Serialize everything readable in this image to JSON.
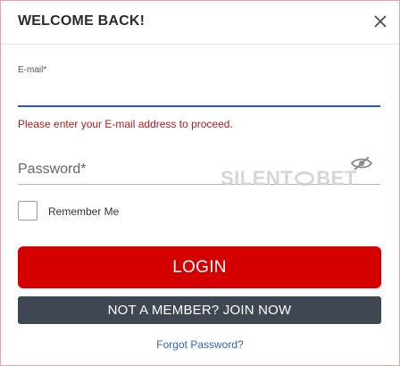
{
  "dialog": {
    "title": "WELCOME BACK!"
  },
  "form": {
    "email_label": "E-mail*",
    "email_value": "",
    "email_error": "Please enter your E-mail address to proceed.",
    "password_placeholder": "Password*",
    "password_value": "",
    "remember_label": "Remember Me",
    "remember_checked": false
  },
  "buttons": {
    "login_label": "LOGIN",
    "join_label": "NOT A MEMBER? JOIN NOW"
  },
  "links": {
    "forgot_password": "Forgot Password?"
  },
  "watermark": {
    "left": "SILENT",
    "right": "BET"
  },
  "icons": {
    "close": "close-icon",
    "password_toggle": "eye-slash-icon"
  },
  "colors": {
    "primary_red": "#d40000",
    "dark_button": "#3f4753",
    "error_text": "#b51a1a",
    "link_blue": "#2f64b5",
    "focus_underline": "#2c5aa8"
  }
}
